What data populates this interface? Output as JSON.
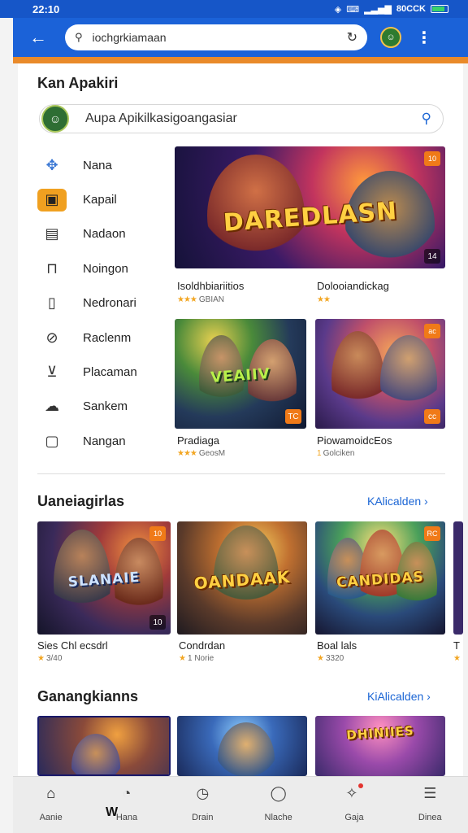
{
  "status": {
    "time": "22:10",
    "battery_label": "80CCK"
  },
  "appbar": {
    "url": "iochgrkiamaan",
    "back_icon": "arrow-left-icon",
    "reload_icon": "reload-icon",
    "more_icon": "kebab-icon"
  },
  "main": {
    "title": "Kan Apakiri",
    "search_placeholder": "Aupa Apikilkasigoangasiar"
  },
  "sidebar": {
    "items": [
      {
        "label": "Nana",
        "icon": "controller-icon"
      },
      {
        "label": "Kapail",
        "icon": "gamepad-icon",
        "active": true
      },
      {
        "label": "Nadaon",
        "icon": "document-icon"
      },
      {
        "label": "Noingon",
        "icon": "gift-icon"
      },
      {
        "label": "Nedronari",
        "icon": "file-icon"
      },
      {
        "label": "Raclenm",
        "icon": "tag-icon"
      },
      {
        "label": "Placaman",
        "icon": "flag-icon"
      },
      {
        "label": "Sankem",
        "icon": "puzzle-icon"
      },
      {
        "label": "Nangan",
        "icon": "tablet-icon"
      }
    ]
  },
  "featured": [
    {
      "title": "Isoldhbiariitios",
      "rating": "",
      "rating_text": "GBIAN",
      "logo": "DAREDLASN",
      "badge": "10",
      "badge2": "14"
    },
    {
      "title": "Dolooiandickag",
      "rating": "",
      "rating_text": ""
    },
    {
      "title": "Pradiaga",
      "rating": "",
      "rating_text": "GeosM",
      "logo": "VEAIIV",
      "badge": "TC"
    },
    {
      "title": "PiowamoidcEos",
      "rating": "",
      "rating_text": "Golciken",
      "rating_prefix": "1",
      "badge": "ac",
      "badge2": "cc"
    }
  ],
  "section1": {
    "title": "Uaneiagirlas",
    "see_more": "KAlicalden",
    "items": [
      {
        "title": "Sies Chl ecsdrl",
        "rating": "",
        "rating_text": "3/40",
        "logo": "SLANAIE",
        "badge": "10",
        "badge2": "10"
      },
      {
        "title": "Condrdan",
        "rating": "1",
        "rating_text": "Norie",
        "logo": "OANDAAK"
      },
      {
        "title": "Boal lals",
        "rating": "",
        "rating_text": "3320",
        "logo": "CANDIDAS",
        "badge": "RC"
      },
      {
        "title": "T",
        "rating": "",
        "rating_text": ""
      }
    ]
  },
  "section2": {
    "title": "Ganangkianns",
    "see_more": "KiAlicalden",
    "items": [
      {
        "logo": ""
      },
      {
        "logo": ""
      },
      {
        "logo": "DHINIIES"
      }
    ]
  },
  "bottom_nav": [
    {
      "label": "Aanie",
      "icon": "home-icon",
      "active": true
    },
    {
      "label": "Hana",
      "icon": "chat-icon"
    },
    {
      "label": "Drain",
      "icon": "clock-icon"
    },
    {
      "label": "Nlache",
      "icon": "shield-icon"
    },
    {
      "label": "Gaja",
      "icon": "games-icon",
      "dot": true
    },
    {
      "label": "Dinea",
      "icon": "menu-icon"
    }
  ],
  "bottom_sub": "W",
  "colors": {
    "accent": "#1b62d8",
    "stripe": "#e98a2a",
    "link": "#1c66d5",
    "star": "#f2a623"
  }
}
